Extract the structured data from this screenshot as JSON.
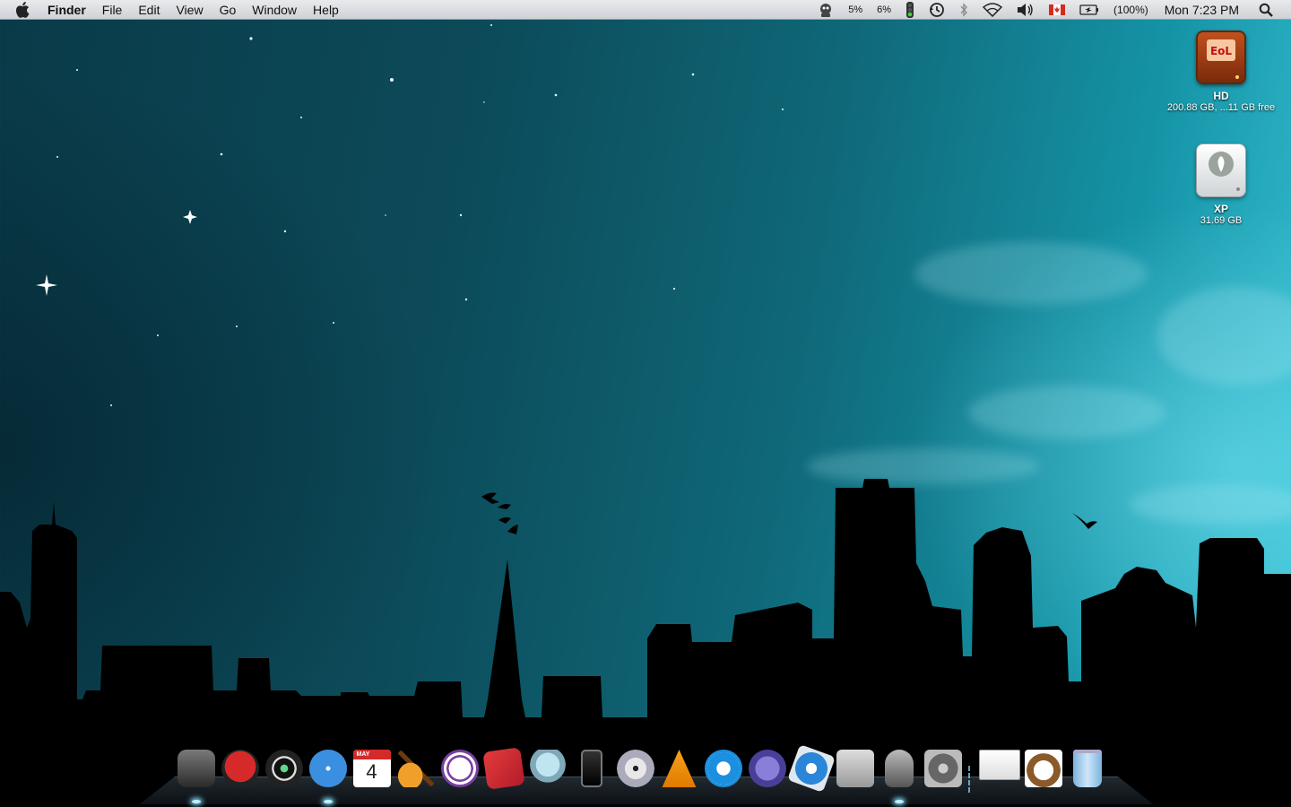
{
  "menubar": {
    "apple_icon": "apple-logo-icon",
    "app_name": "Finder",
    "menus": [
      "File",
      "Edit",
      "View",
      "Go",
      "Window",
      "Help"
    ],
    "status": {
      "cpu1": "5%",
      "cpu2": "6%",
      "battery": "(100%)",
      "clock": "Mon 7:23 PM"
    }
  },
  "desktop": {
    "disks": [
      {
        "name": "HD",
        "sub": "200.88 GB, ...11 GB free"
      },
      {
        "name": "XP",
        "sub": "31.69 GB"
      }
    ]
  },
  "dock": {
    "items": [
      "robot-app",
      "ninja-app",
      "camera-app",
      "safari",
      "ical-4",
      "garageband",
      "venus-app",
      "flashcard-app",
      "robot-mascot-app",
      "iphone-app",
      "dvd-player",
      "vlc",
      "quicktime",
      "script-editor",
      "xcode-app",
      "automator",
      "robot-helmet-app",
      "system-preferences"
    ],
    "stack_items": [
      "documents-stack",
      "dog-stack",
      "trash"
    ],
    "ical_day": "4",
    "ical_month": "MAY"
  },
  "colors": {
    "menubar": "#dcdfe2",
    "sky_dark": "#0a3a48",
    "sky_light": "#38c3d6"
  }
}
